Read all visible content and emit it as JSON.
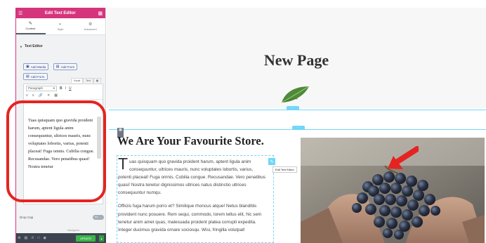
{
  "sidebar": {
    "title": "Edit Text Editor",
    "tabs": [
      {
        "label": "Content",
        "icon": "pencil-icon"
      },
      {
        "label": "Style",
        "icon": "half-circle-icon"
      },
      {
        "label": "Advanced",
        "icon": "gear-icon"
      }
    ],
    "section_title": "Text Editor",
    "add_media_label": "Add Media",
    "add_form_label_1": "Add Form",
    "add_form_label_2": "Add Form",
    "editor_tabs": [
      "Visual",
      "Text"
    ],
    "paragraph_select": "Paragraph",
    "editor_text": "Tuas quisquam quo gravida proident harum, aptent ligula anim consequuntur, ultrices mauris, nunc voluptates lobortis, varius, potenti placeat! Fuga omnis. Cubilia congue. Recusandae. Vero penatibus quasi! Nostra tenetur",
    "drop_cap_label": "Drop Cap",
    "drop_cap_toggle": "NO",
    "navigator_label": "Navigator",
    "update_label": "UPDATE"
  },
  "canvas": {
    "page_title": "New Page",
    "heading": "We Are Your Favourite Store.",
    "tooltip": "Edit Text Editor",
    "drop_cap": "T",
    "para1_line1": "uas quisquam quo gravida proident harum, aptent ligula anim",
    "para1_line2": "consequuntur, ultrices mauris, nunc voluptates lobortis, varius,",
    "para1_rest": "potenti placeat! Fuga omnis. Cubilia congue. Recusandae. Vero penatibus quasi! Nostra tenetur dignissimos ultrices natus distinctio ultrices consequuntur numqu.",
    "para2": "Officiis fuga harum porro et? Similique rhoncus atque! Netus blanditiis provident nunc posuere. Rem sequi, commodo, lorem tellus elit, hic sem tenetur anim amet quas, malesuada proident platea corrupti expedita.",
    "para3": "Integer ducimus gravida ornare sociosqu. Wisi, fringilla volutpat!"
  },
  "colors": {
    "brand": "#d5357c",
    "accent_handles": "#71d7f7",
    "annotation": "#e52421",
    "update": "#39b54a"
  }
}
